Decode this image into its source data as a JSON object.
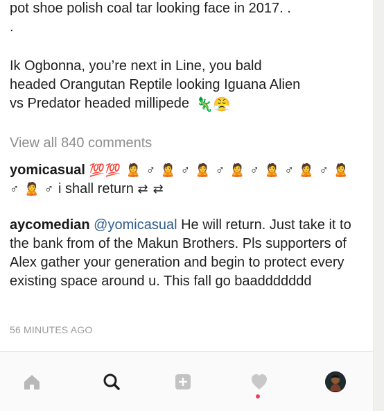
{
  "post": {
    "caption_lines": [
      "pot shoe polish coal tar looking face in 2017. .",
      ".",
      "",
      "Ik Ogbonna, you’re next in Line, you bald",
      "headed Orangutan Reptile looking Iguana Alien",
      "vs Predator headed millipede"
    ],
    "caption_emojis": "🦎😤",
    "view_comments": "View all 840 comments",
    "comments": [
      {
        "username": "yomicasual",
        "emoji_text": "💯💯 🙎 ♂ 🙎 ♂ 🙎 ♂ 🙎 ♂ 🙎 ♂ 🙎 ♂ 🙎 ♂ 🙎 ♂",
        "text": "i shall return",
        "trailing_emojis": "⇄ ⇄"
      },
      {
        "username": "aycomedian",
        "mention": "@yomicasual",
        "text": "He will return. Just take it to the bank from of the Makun Brothers. Pls supporters of Alex gather your generation and begin to protect every existing space around u. This fall go baaddddddd"
      }
    ],
    "time": "56 MINUTES AGO"
  },
  "nav": {
    "home_icon": "home-icon",
    "search_icon": "search-icon",
    "add_icon": "add-post-icon",
    "activity_icon": "heart-icon",
    "profile_icon": "profile-avatar-icon"
  },
  "colors": {
    "background": "#ffffff",
    "text": "#1f1f1f",
    "muted": "#8e8e8e",
    "link": "#2f5d8f",
    "nav": "#fafafa",
    "active": "#e3465c"
  }
}
